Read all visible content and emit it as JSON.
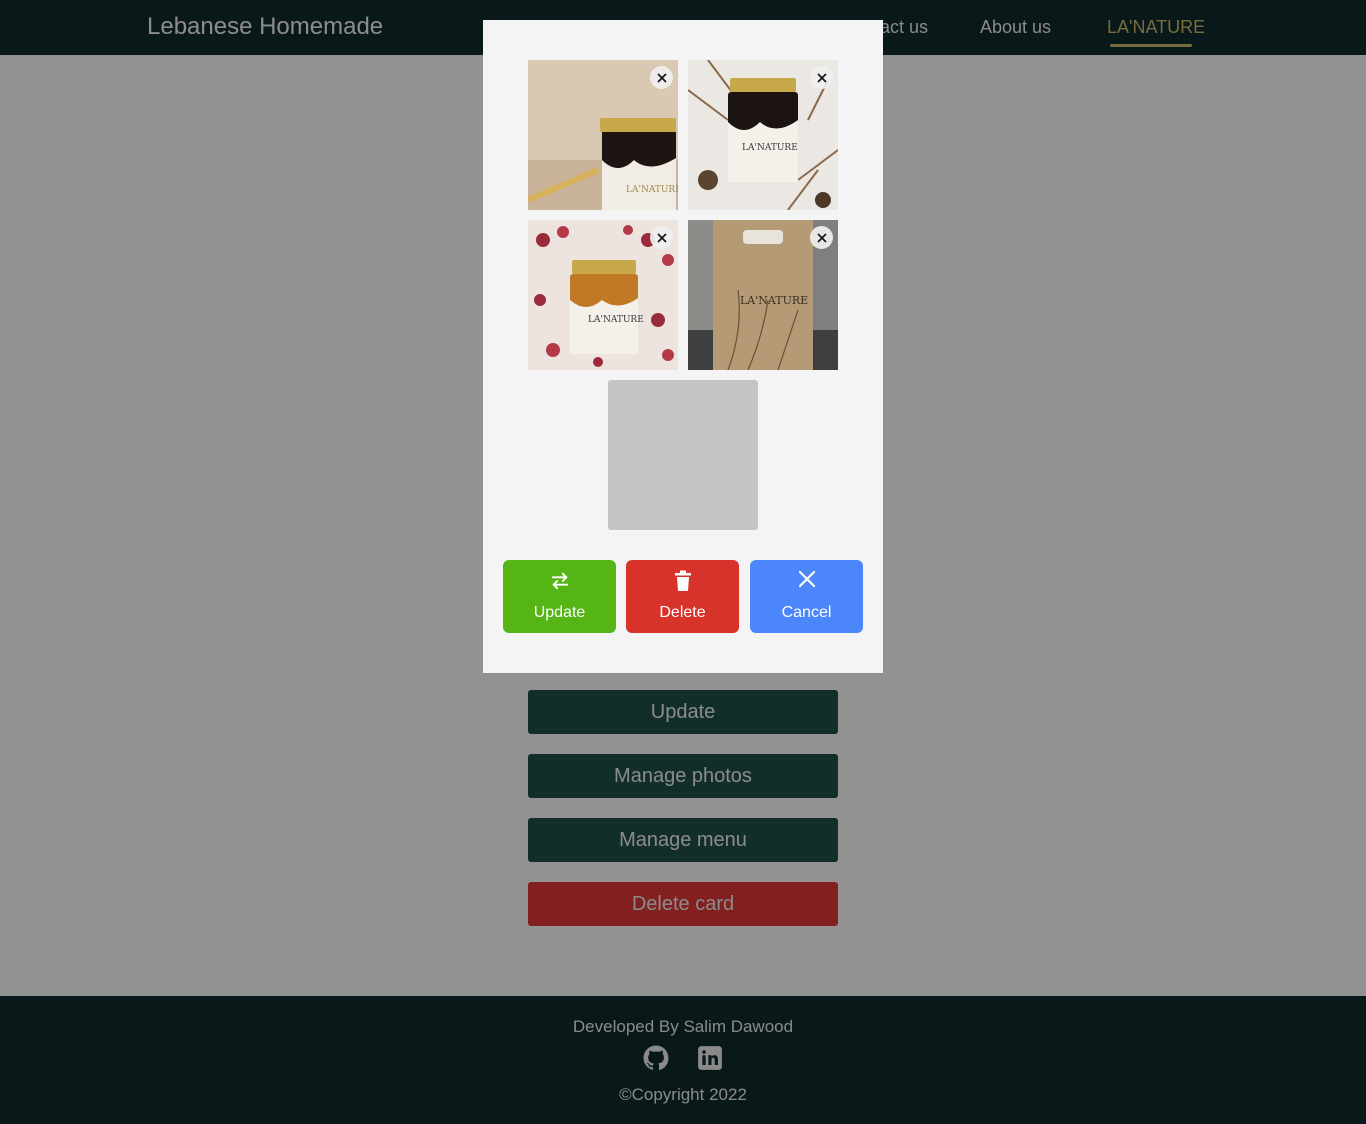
{
  "navbar": {
    "brand": "Lebanese Homemade",
    "links": [
      {
        "label": "Contact us"
      },
      {
        "label": "About us"
      },
      {
        "label": "LA'NATURE",
        "active": true
      }
    ]
  },
  "card_actions": {
    "update_label": "Update",
    "manage_photos_label": "Manage photos",
    "manage_menu_label": "Manage menu",
    "delete_card_label": "Delete card"
  },
  "modal": {
    "photos": [
      {
        "brand_text": "LA'NATURE",
        "description": "dark honey jar on beige background"
      },
      {
        "brand_text": "LA'NATURE",
        "description": "dark honey jar with dried branches"
      },
      {
        "brand_text": "LA'NATURE",
        "description": "amber honey jar with dried berries"
      },
      {
        "brand_text": "LA'NATURE",
        "description": "kraft paper gift box"
      }
    ],
    "remove_symbol": "×",
    "actions": {
      "update_label": "Update",
      "delete_label": "Delete",
      "cancel_label": "Cancel"
    }
  },
  "footer": {
    "developer": "Developed By Salim Dawood",
    "copyright": "©Copyright 2022",
    "icons": [
      "github-icon",
      "linkedin-icon"
    ]
  },
  "colors": {
    "navbar_bg": "#0f2a2b",
    "accent_gold": "#c9b56a",
    "dark_button": "#1f4d47",
    "danger": "#d7332a",
    "update_green": "#55b514",
    "cancel_blue": "#4b86fb"
  }
}
